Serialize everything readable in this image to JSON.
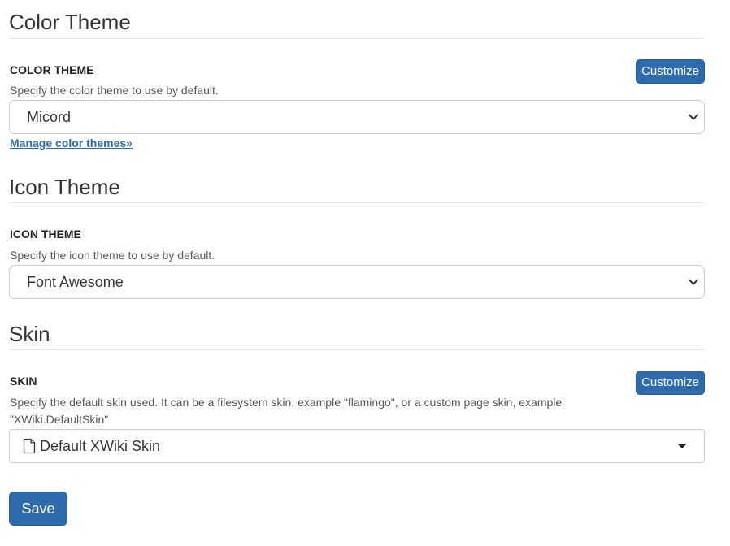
{
  "color_section": {
    "heading": "Color Theme",
    "label": "COLOR THEME",
    "hint": "Specify the color theme to use by default.",
    "customize_label": "Customize",
    "selected": "Micord",
    "manage_link": "Manage color themes»"
  },
  "icon_section": {
    "heading": "Icon Theme",
    "label": "ICON THEME",
    "hint": "Specify the icon theme to use by default.",
    "selected": "Font Awesome"
  },
  "skin_section": {
    "heading": "Skin",
    "label": "SKIN",
    "hint": "Specify the default skin used. It can be a filesystem skin, example \"flamingo\", or a custom page skin, example \"XWiki.DefaultSkin\"",
    "customize_label": "Customize",
    "selected": "Default XWiki Skin",
    "icon": "file-icon"
  },
  "form": {
    "save_label": "Save"
  },
  "colors": {
    "primary": "#2e6bac",
    "text": "#333333",
    "border": "#cccccc"
  }
}
